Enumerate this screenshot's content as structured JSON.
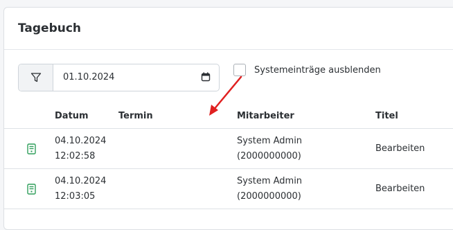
{
  "panel": {
    "title": "Tagebuch"
  },
  "filter": {
    "date_value": "01.10.2024",
    "hide_system_label": "Systemeinträge ausblenden",
    "hide_system_checked": false
  },
  "table": {
    "columns": [
      "Datum",
      "Termin",
      "Mitarbeiter",
      "Titel"
    ],
    "rows": [
      {
        "datum": "04.10.2024",
        "zeit": "12:02:58",
        "termin": "",
        "mitarbeiter_name": "System Admin",
        "mitarbeiter_id": "(2000000000)",
        "titel": "Bearbeiten",
        "icon": "document-icon"
      },
      {
        "datum": "04.10.2024",
        "zeit": "12:03:05",
        "termin": "",
        "mitarbeiter_name": "System Admin",
        "mitarbeiter_id": "(2000000000)",
        "titel": "Bearbeiten",
        "icon": "document-icon"
      }
    ]
  },
  "colors": {
    "accent": "#2e9e5a",
    "annotation": "#e02020"
  }
}
